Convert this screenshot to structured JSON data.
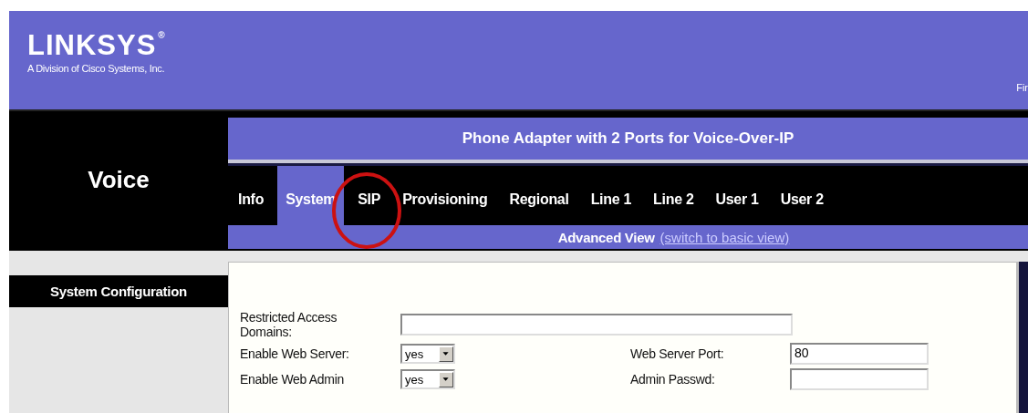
{
  "brand": {
    "logo": "LINKSYS",
    "registered": "®",
    "tagline": "A Division of Cisco Systems, Inc.",
    "corner_text": "Fir"
  },
  "section": "Voice",
  "product_title": "Phone Adapter with 2 Ports for Voice-Over-IP",
  "tabs": [
    {
      "label": "Info",
      "selected": false
    },
    {
      "label": "System",
      "selected": true
    },
    {
      "label": "SIP",
      "selected": false
    },
    {
      "label": "Provisioning",
      "selected": false
    },
    {
      "label": "Regional",
      "selected": false
    },
    {
      "label": "Line 1",
      "selected": false
    },
    {
      "label": "Line 2",
      "selected": false
    },
    {
      "label": "User 1",
      "selected": false
    },
    {
      "label": "User 2",
      "selected": false
    }
  ],
  "view": {
    "label": "Advanced View",
    "link": "(switch to basic view)"
  },
  "sidebar": {
    "heading": "System Configuration"
  },
  "form": {
    "rows": [
      {
        "fields": [
          {
            "label": "Restricted Access Domains:",
            "kind": "text",
            "wide": true
          }
        ]
      },
      {
        "fields": [
          {
            "label": "Enable Web Server:",
            "kind": "select",
            "value": "yes"
          },
          {
            "label": "Web Server Port:",
            "kind": "text",
            "value": "80"
          }
        ]
      },
      {
        "fields": [
          {
            "label": "Enable Web Admin",
            "kind": "select",
            "value": "yes"
          },
          {
            "label": "Admin Passwd:",
            "kind": "password"
          }
        ]
      }
    ]
  }
}
